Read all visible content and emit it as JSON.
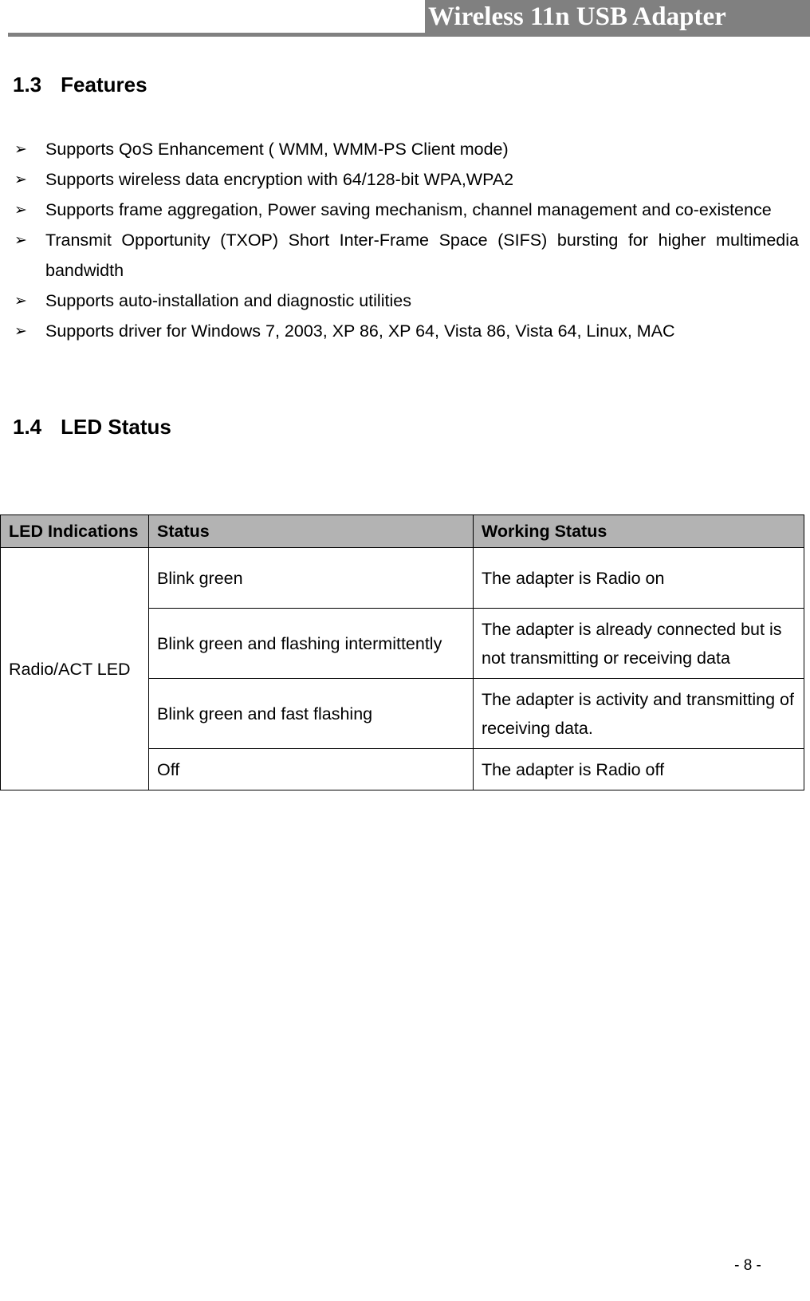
{
  "header": {
    "title": "Wireless 11n USB Adapter",
    "band_color": "#808080",
    "rule_color": "#808080",
    "title_color": "#ffffff"
  },
  "sections": {
    "features": {
      "number": "1.3",
      "title": "Features",
      "bullet_glyph": "➢",
      "items": [
        "Supports QoS Enhancement ( WMM, WMM-PS Client mode)",
        "Supports wireless data encryption with 64/128-bit WPA,WPA2",
        "Supports frame aggregation, Power saving mechanism, channel management and co-existence",
        "Transmit Opportunity (TXOP) Short Inter-Frame Space (SIFS) bursting for higher multimedia bandwidth",
        "Supports auto-installation and diagnostic utilities",
        "Supports driver for Windows 7, 2003, XP 86, XP 64, Vista 86, Vista 64, Linux, MAC"
      ]
    },
    "led_status": {
      "number": "1.4",
      "title": "LED Status"
    }
  },
  "led_table": {
    "header_bg": "#b3b3b3",
    "columns": [
      "LED Indications",
      "Status",
      "Working Status"
    ],
    "row_label": "Radio/ACT LED",
    "rows": [
      {
        "status": "Blink green",
        "working": "The adapter is Radio on"
      },
      {
        "status": "Blink green and flashing intermittently",
        "working": "The adapter is already connected but is not transmitting or receiving data"
      },
      {
        "status": "Blink green and fast flashing",
        "working": "The adapter is activity and transmitting of receiving data."
      },
      {
        "status": "Off",
        "working": "The adapter is Radio off"
      }
    ]
  },
  "footer": {
    "page_number": "- 8 -"
  }
}
